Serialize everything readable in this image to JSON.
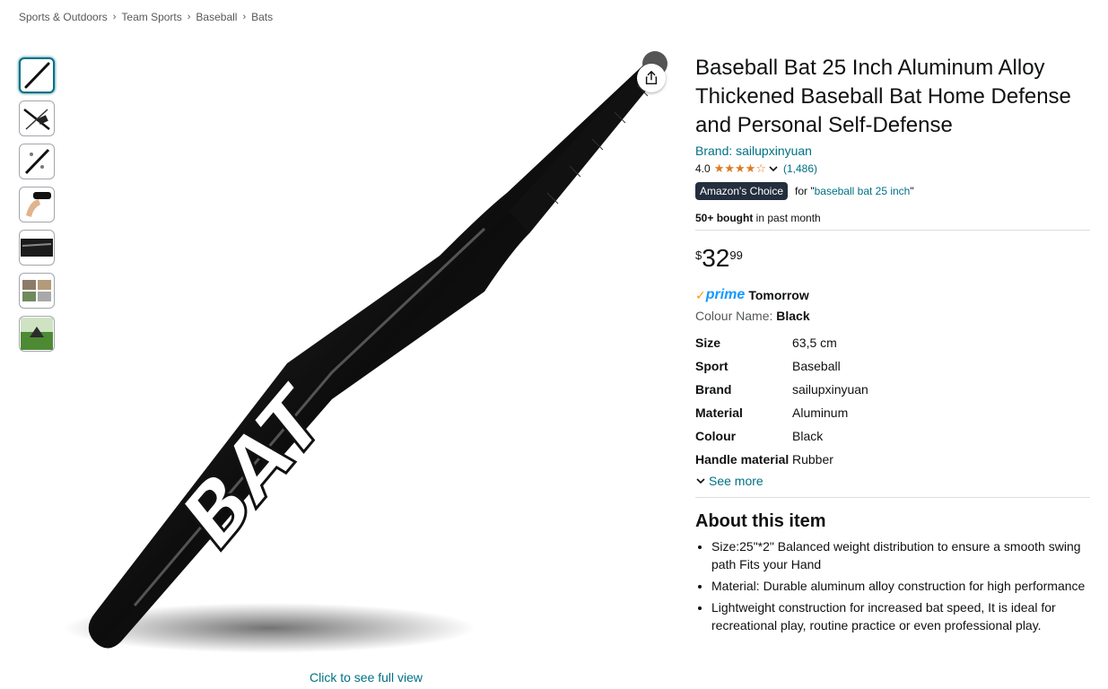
{
  "breadcrumb": [
    "Sports & Outdoors",
    "Team Sports",
    "Baseball",
    "Bats"
  ],
  "breadcrumb_separator": "›",
  "thumbnails": [
    {
      "icon": "bat-thumb-icon",
      "active": true
    },
    {
      "icon": "bat-set-thumb-icon",
      "active": false
    },
    {
      "icon": "bat-detail-thumb-icon",
      "active": false
    },
    {
      "icon": "hand-grip-thumb-icon",
      "active": false
    },
    {
      "icon": "bat-closeup-thumb-icon",
      "active": false
    },
    {
      "icon": "lifestyle-thumb-icon",
      "active": false
    },
    {
      "icon": "outdoor-thumb-icon",
      "active": false
    }
  ],
  "main_image": {
    "bat_text": "BAT",
    "full_view_link": "Click to see full view"
  },
  "product": {
    "title": "Baseball Bat 25 Inch Aluminum Alloy Thickened Baseball Bat Home Defense and Personal Self-Defense",
    "brand_link": "Brand: sailupxinyuan",
    "rating_value": "4.0",
    "rating_stars": 4,
    "review_count": "(1,486)",
    "choice_badge": "Amazon's Choice",
    "choice_for": "for \"",
    "choice_query": "baseball bat 25 inch",
    "choice_close": "\"",
    "bought_bold": "50+ bought",
    "bought_rest": " in past month",
    "price_symbol": "$",
    "price_whole": "32",
    "price_fraction": "99",
    "prime_check": "✓",
    "prime_label": "prime",
    "prime_delivery": "Tomorrow",
    "colour_label": "Colour Name: ",
    "colour_value": "Black"
  },
  "specs": [
    {
      "key": "Size",
      "value": "63,5 cm"
    },
    {
      "key": "Sport",
      "value": "Baseball"
    },
    {
      "key": "Brand",
      "value": "sailupxinyuan"
    },
    {
      "key": "Material",
      "value": "Aluminum"
    },
    {
      "key": "Colour",
      "value": "Black"
    },
    {
      "key": "Handle material",
      "value": "Rubber"
    }
  ],
  "see_more": "See more",
  "about": {
    "title": "About this item",
    "bullets": [
      "Size:25\"*2\" Balanced weight distribution to ensure a smooth swing path Fits your Hand",
      "Material: Durable aluminum alloy construction for high performance",
      "Lightweight construction for increased bat speed, It is ideal for recreational play, routine practice or even professional play."
    ]
  },
  "colors": {
    "link": "#007185",
    "star": "#de7921",
    "badge": "#232f3e",
    "prime": "#1399ff"
  }
}
